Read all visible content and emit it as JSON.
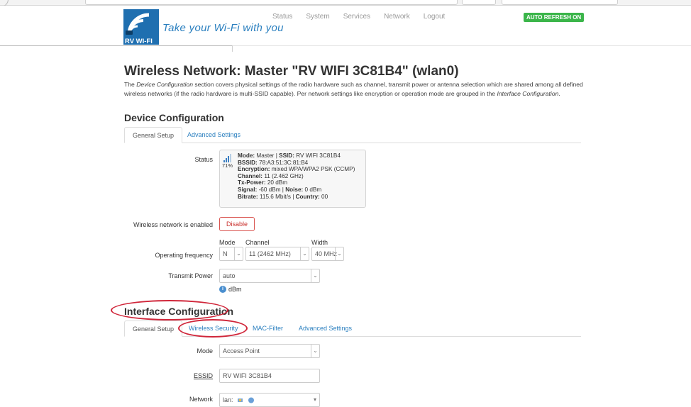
{
  "header": {
    "tagline": "Take your Wi-Fi with you",
    "logo_text": "RV WI-FI",
    "nav": [
      "Status",
      "System",
      "Services",
      "Network",
      "Logout"
    ],
    "auto_refresh": "AUTO REFRESH ON"
  },
  "page": {
    "title": "Wireless Network: Master \"RV WIFI 3C81B4\" (wlan0)",
    "description_parts": {
      "p1": "The ",
      "em1": "Device Configuration",
      "p2": " section covers physical settings of the radio hardware such as channel, transmit power or antenna selection which are shared among all defined wireless networks (if the radio hardware is multi-SSID capable). Per network settings like encryption or operation mode are grouped in the ",
      "em2": "Interface Configuration",
      "p3": "."
    }
  },
  "device": {
    "title": "Device Configuration",
    "tabs": [
      "General Setup",
      "Advanced Settings"
    ],
    "status_label": "Status",
    "status": {
      "percent": "71%",
      "mode_label": "Mode:",
      "mode": "Master",
      "ssid_label": "SSID:",
      "ssid": "RV WIFI 3C81B4",
      "bssid_label": "BSSID:",
      "bssid": "78:A3:51:3C:81:B4",
      "encryption_label": "Encryption:",
      "encryption": "mixed WPA/WPA2 PSK (CCMP)",
      "channel_label": "Channel:",
      "channel": "11 (2.462 GHz)",
      "txpower_label": "Tx-Power:",
      "txpower": "20 dBm",
      "signal_label": "Signal:",
      "signal": "-60 dBm",
      "noise_label": "Noise:",
      "noise": "0 dBm",
      "bitrate_label": "Bitrate:",
      "bitrate": "115.6 Mbit/s",
      "country_label": "Country:",
      "country": "00"
    },
    "enabled_label": "Wireless network is enabled",
    "disable_button": "Disable",
    "freq_label": "Operating frequency",
    "mode_sub": "Mode",
    "channel_sub": "Channel",
    "width_sub": "Width",
    "mode_value": "N",
    "channel_value": "11 (2462 MHz)",
    "width_value": "40 MHz",
    "txpower_field_label": "Transmit Power",
    "txpower_value": "auto",
    "unit": "dBm"
  },
  "interface": {
    "title": "Interface Configuration",
    "tabs": [
      "General Setup",
      "Wireless Security",
      "MAC-Filter",
      "Advanced Settings"
    ],
    "mode_label": "Mode",
    "mode_value": "Access Point",
    "essid_label": "ESSID",
    "essid_value": "RV WIFI 3C81B4",
    "network_label": "Network",
    "network_value": "lan:"
  },
  "colors": {
    "accent": "#2a7fbf",
    "annotation": "#d0263a",
    "refresh": "#3bb54a",
    "danger": "#d9534f"
  }
}
